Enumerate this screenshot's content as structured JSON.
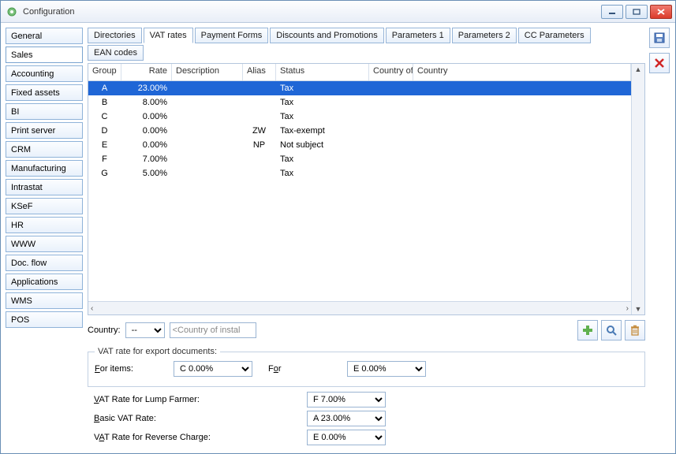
{
  "window": {
    "title": "Configuration"
  },
  "leftnav": [
    "General",
    "Sales",
    "Accounting",
    "Fixed assets",
    "BI",
    "Print server",
    "CRM",
    "Manufacturing",
    "Intrastat",
    "KSeF",
    "HR",
    "WWW",
    "Doc. flow",
    "Applications",
    "WMS",
    "POS"
  ],
  "leftnav_active": 1,
  "tabs": [
    "Directories",
    "VAT rates",
    "Payment Forms",
    "Discounts and Promotions",
    "Parameters 1",
    "Parameters 2",
    "CC Parameters",
    "EAN codes"
  ],
  "tabs_active": 1,
  "grid": {
    "headers": [
      "Group",
      "Rate",
      "Description",
      "Alias",
      "Status",
      "Country of",
      "Country"
    ],
    "rows": [
      {
        "group": "A",
        "rate": "23.00%",
        "desc": "",
        "alias": "",
        "status": "Tax",
        "cof": "",
        "country": ""
      },
      {
        "group": "B",
        "rate": "8.00%",
        "desc": "",
        "alias": "",
        "status": "Tax",
        "cof": "",
        "country": ""
      },
      {
        "group": "C",
        "rate": "0.00%",
        "desc": "",
        "alias": "",
        "status": "Tax",
        "cof": "",
        "country": ""
      },
      {
        "group": "D",
        "rate": "0.00%",
        "desc": "",
        "alias": "ZW",
        "status": "Tax-exempt",
        "cof": "",
        "country": ""
      },
      {
        "group": "E",
        "rate": "0.00%",
        "desc": "",
        "alias": "NP",
        "status": "Not subject",
        "cof": "",
        "country": ""
      },
      {
        "group": "F",
        "rate": "7.00%",
        "desc": "",
        "alias": "",
        "status": "Tax",
        "cof": "",
        "country": ""
      },
      {
        "group": "G",
        "rate": "5.00%",
        "desc": "",
        "alias": "",
        "status": "Tax",
        "cof": "",
        "country": ""
      }
    ],
    "selected": 0
  },
  "country": {
    "label": "Country:",
    "value": "--",
    "install_placeholder": "<Country of instal"
  },
  "export_group": {
    "legend": "VAT rate for export documents:",
    "for_items_label": "For items:",
    "for_items_value": "C 0.00%",
    "for_label": "For",
    "for_value": "E 0.00%"
  },
  "bottom": {
    "lump_label": "VAT Rate for Lump Farmer:",
    "lump_value": "F 7.00%",
    "basic_label": "Basic VAT Rate:",
    "basic_value": "A 23.00%",
    "rev_label": "VAT Rate for Reverse Charge:",
    "rev_value": "E 0.00%"
  }
}
